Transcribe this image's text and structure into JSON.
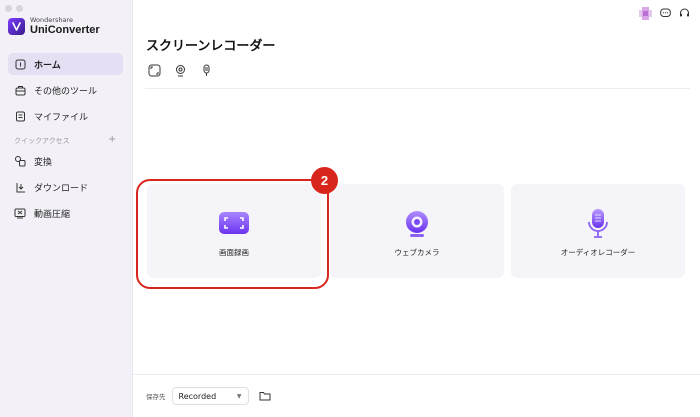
{
  "brand": {
    "small": "Wondershare",
    "name": "UniConverter"
  },
  "sidebar": {
    "items": [
      {
        "label": "ホーム",
        "icon": "home-icon"
      },
      {
        "label": "その他のツール",
        "icon": "toolbox-icon"
      },
      {
        "label": "マイファイル",
        "icon": "file-icon"
      }
    ],
    "section_label": "クイックアクセス",
    "section_plus": "+",
    "quick": [
      {
        "label": "変換",
        "icon": "convert-icon"
      },
      {
        "label": "ダウンロード",
        "icon": "download-icon"
      },
      {
        "label": "動画圧縮",
        "icon": "compress-icon"
      }
    ]
  },
  "main": {
    "title": "スクリーンレコーダー",
    "cards": [
      {
        "label": "画面録画",
        "icon": "screen-record-icon"
      },
      {
        "label": "ウェブカメラ",
        "icon": "webcam-icon"
      },
      {
        "label": "オーディオレコーダー",
        "icon": "microphone-icon"
      }
    ],
    "badge": "2"
  },
  "footer": {
    "label": "保存先",
    "select_value": "Recorded"
  },
  "colors": {
    "accent": "#7b3cff",
    "highlight": "#d9261c",
    "sidebar_bg": "#f3f1f7",
    "card_bg": "#f5f4f8"
  }
}
